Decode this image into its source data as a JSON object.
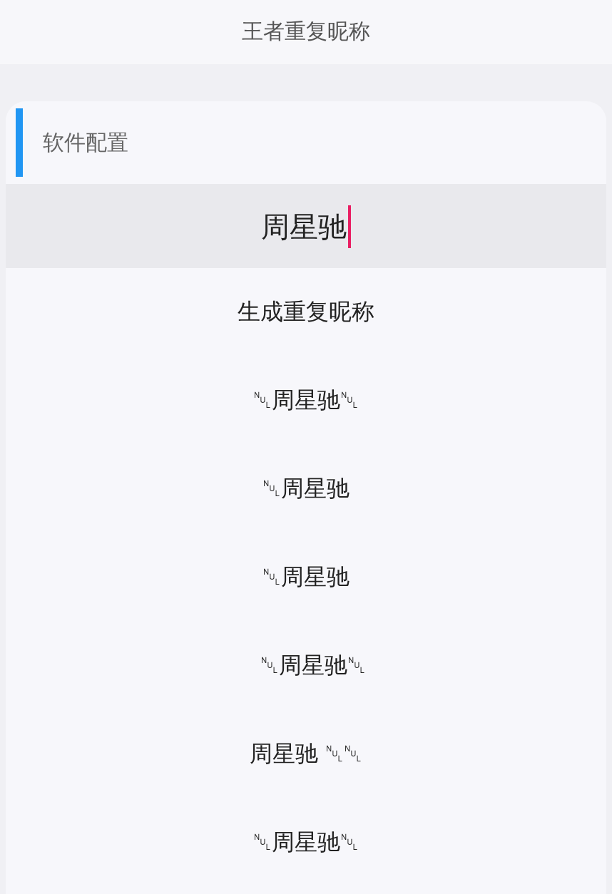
{
  "header": {
    "title": "王者重复昵称"
  },
  "section": {
    "title": "软件配置"
  },
  "input": {
    "value": "周星驰"
  },
  "generate_button": {
    "label": "生成重复昵称"
  },
  "results": [
    {
      "text": "␀周星驰␀"
    },
    {
      "text": "␀周星驰"
    },
    {
      "text": "␀周星驰"
    },
    {
      "text": "  ␀周星驰␀"
    },
    {
      "text": "周星驰 ␀␀"
    },
    {
      "text": "␀周星驰␀"
    }
  ]
}
